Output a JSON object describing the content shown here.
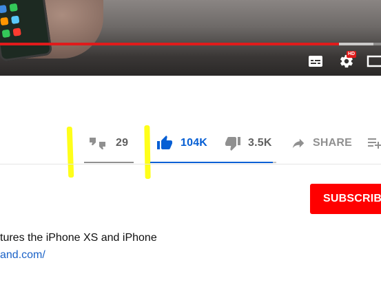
{
  "player": {
    "progress_fraction": 0.89,
    "buffered_fraction": 0.09,
    "controls": [
      {
        "icon": "subtitles-icon"
      },
      {
        "icon": "settings-icon",
        "badge": "HD"
      },
      {
        "icon": "theater-mode-icon"
      }
    ]
  },
  "actions": {
    "dislike_alt": {
      "icon": "thumbs-down-icon",
      "count": "29"
    },
    "like": {
      "icon": "thumbs-up-icon",
      "count": "104K"
    },
    "dislike": {
      "icon": "thumbs-down-icon",
      "count": "3.5K"
    },
    "share": {
      "icon": "share-arrow-icon",
      "label": "SHARE"
    },
    "save": {
      "icon": "add-to-playlist-icon"
    }
  },
  "annotations": {
    "highlight_color": "#ffff1a"
  },
  "channel": {
    "subscribe_label": "SUBSCRIBE"
  },
  "description": {
    "line1": "tures the iPhone XS and iPhone",
    "link": "and.com/"
  },
  "colors": {
    "like_blue": "#065fd4",
    "icon_gray": "#909090",
    "subscribe_red": "#ff0000",
    "progress_red": "#e01b1b",
    "link_blue": "#1a62c7"
  }
}
